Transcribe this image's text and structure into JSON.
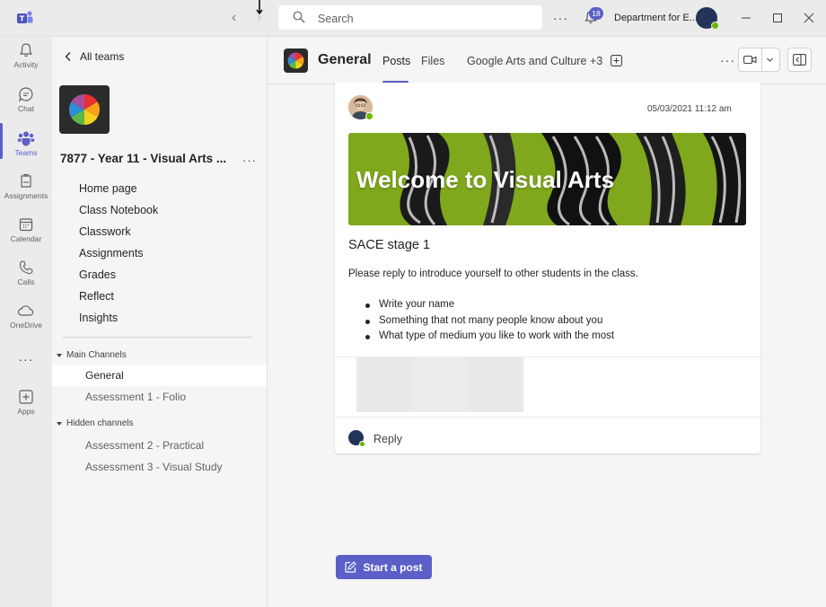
{
  "titlebar": {
    "search_placeholder": "Search",
    "notification_count": "18",
    "org_name": "Department for E..."
  },
  "rail": {
    "items": [
      {
        "label": "Activity"
      },
      {
        "label": "Chat"
      },
      {
        "label": "Teams"
      },
      {
        "label": "Assignments"
      },
      {
        "label": "Calendar"
      },
      {
        "label": "Calls"
      },
      {
        "label": "OneDrive"
      },
      {
        "label": "Apps"
      }
    ],
    "active": "Teams"
  },
  "team_panel": {
    "back_label": "All teams",
    "team_name": "7877 - Year 11 - Visual Arts ...",
    "tabs": [
      "Home page",
      "Class Notebook",
      "Classwork",
      "Assignments",
      "Grades",
      "Reflect",
      "Insights"
    ],
    "sections": [
      {
        "title": "Main Channels",
        "channels": [
          "General",
          "Assessment 1 - Folio"
        ]
      },
      {
        "title": "Hidden channels",
        "channels": [
          "Assessment 2 - Practical",
          "Assessment 3 - Visual Study"
        ]
      }
    ],
    "selected_channel": "General"
  },
  "channel_header": {
    "title": "General",
    "tabs": [
      "Posts",
      "Files",
      "Google Arts and Culture"
    ],
    "active_tab": "Posts",
    "more_tabs": "+3"
  },
  "post": {
    "timestamp": "05/03/2021 11:12 am",
    "banner_text": "Welcome to Visual Arts",
    "subject": "SACE stage 1",
    "body": "Please reply to introduce yourself to other students in the class.",
    "bullets": [
      "Write your name",
      "Something that not many people know about you",
      "What type of medium you like to work with the most"
    ],
    "reply_label": "Reply"
  },
  "start_post_label": "Start a post",
  "colors": {
    "accent": "#5b5fc7",
    "presence_available": "#6bb700",
    "banner_green": "#7fa81c"
  }
}
